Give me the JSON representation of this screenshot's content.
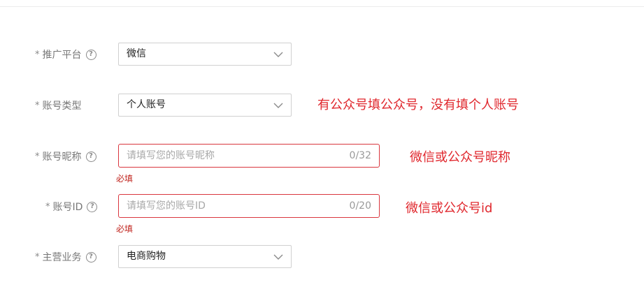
{
  "form": {
    "platform": {
      "label": "推广平台",
      "value": "微信",
      "required_mark": "*",
      "help_glyph": "?"
    },
    "account_type": {
      "label": "账号类型",
      "value": "个人账号",
      "required_mark": "*"
    },
    "nickname": {
      "label": "账号昵称",
      "placeholder": "请填写您的账号昵称",
      "counter": "0/32",
      "error": "必填",
      "required_mark": "*",
      "help_glyph": "?"
    },
    "account_id": {
      "label": "账号ID",
      "placeholder": "请填写您的账号ID",
      "counter": "0/20",
      "error": "必填",
      "required_mark": "*",
      "help_glyph": "?"
    },
    "main_business": {
      "label": "主营业务",
      "value": "电商购物",
      "required_mark": "*",
      "help_glyph": "?"
    }
  },
  "annotations": {
    "account_type_note": "有公众号填公众号，没有填个人账号",
    "nickname_note": "微信或公众号昵称",
    "account_id_note": "微信或公众号id"
  },
  "colors": {
    "error_border": "#d9363e",
    "annotation_red": "#e0282e",
    "error_text": "#c0241e"
  },
  "icons": {
    "help": "question-circle-icon",
    "dropdown": "chevron-down-icon"
  }
}
